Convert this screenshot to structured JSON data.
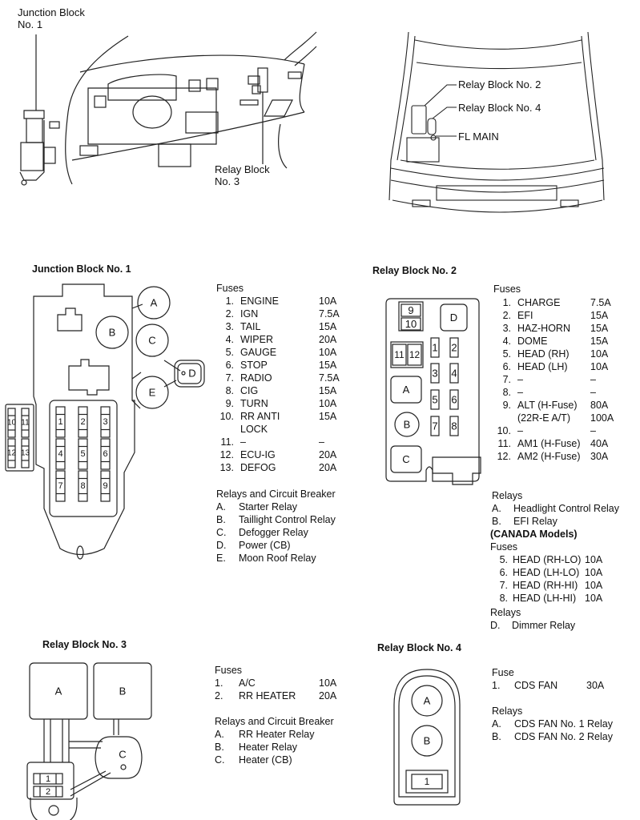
{
  "locations": {
    "junction_block_1_callout": [
      "Junction Block",
      "No. 1"
    ],
    "relay_block_3_callout": [
      "Relay Block",
      "No. 3"
    ],
    "engine_bay_callouts": [
      "Relay Block No. 2",
      "Relay Block No. 4",
      "FL MAIN"
    ]
  },
  "junction_block_1": {
    "title": "Junction Block No. 1",
    "diagram": {
      "relays": [
        "A",
        "B",
        "C",
        "D",
        "E"
      ],
      "fuse_slots": [
        "1",
        "2",
        "3",
        "4",
        "5",
        "6",
        "7",
        "8",
        "9",
        "10",
        "11",
        "12",
        "13"
      ]
    },
    "fuses_heading": "Fuses",
    "fuses": [
      {
        "num": "1.",
        "name": "ENGINE",
        "amp": "10A"
      },
      {
        "num": "2.",
        "name": "IGN",
        "amp": "7.5A"
      },
      {
        "num": "3.",
        "name": "TAIL",
        "amp": "15A"
      },
      {
        "num": "4.",
        "name": "WIPER",
        "amp": "20A"
      },
      {
        "num": "5.",
        "name": "GAUGE",
        "amp": "10A"
      },
      {
        "num": "6.",
        "name": "STOP",
        "amp": "15A"
      },
      {
        "num": "7.",
        "name": "RADIO",
        "amp": "7.5A"
      },
      {
        "num": "8.",
        "name": "CIG",
        "amp": "15A"
      },
      {
        "num": "9.",
        "name": "TURN",
        "amp": "10A"
      },
      {
        "num": "10.",
        "name": "RR ANTI",
        "amp": "15A"
      },
      {
        "num": "",
        "name": "LOCK",
        "amp": ""
      },
      {
        "num": "11.",
        "name": "–",
        "amp": "–"
      },
      {
        "num": "12.",
        "name": "ECU-IG",
        "amp": "20A"
      },
      {
        "num": "13.",
        "name": "DEFOG",
        "amp": "20A"
      }
    ],
    "relays_heading": "Relays and Circuit Breaker",
    "relays": [
      {
        "letter": "A.",
        "name": "Starter Relay"
      },
      {
        "letter": "B.",
        "name": "Taillight Control Relay"
      },
      {
        "letter": "C.",
        "name": "Defogger Relay"
      },
      {
        "letter": "D.",
        "name": "Power (CB)"
      },
      {
        "letter": "E.",
        "name": "Moon Roof Relay"
      }
    ]
  },
  "relay_block_2": {
    "title": "Relay Block No. 2",
    "diagram": {
      "relays": [
        "A",
        "B",
        "C",
        "D"
      ],
      "fuse_slots": [
        "1",
        "2",
        "3",
        "4",
        "5",
        "6",
        "7",
        "8",
        "9",
        "10",
        "11",
        "12"
      ]
    },
    "fuses_heading": "Fuses",
    "fuses": [
      {
        "num": "1.",
        "name": "CHARGE",
        "amp": "7.5A"
      },
      {
        "num": "2.",
        "name": "EFI",
        "amp": "15A"
      },
      {
        "num": "3.",
        "name": "HAZ-HORN",
        "amp": "15A"
      },
      {
        "num": "4.",
        "name": "DOME",
        "amp": "15A"
      },
      {
        "num": "5.",
        "name": "HEAD (RH)",
        "amp": "10A"
      },
      {
        "num": "6.",
        "name": "HEAD (LH)",
        "amp": "10A"
      },
      {
        "num": "7.",
        "name": "–",
        "amp": "–"
      },
      {
        "num": "8.",
        "name": "–",
        "amp": "–"
      },
      {
        "num": "9.",
        "name": "ALT (H-Fuse)",
        "amp": "80A"
      },
      {
        "num": "",
        "name": "(22R-E A/T)",
        "amp": "100A"
      },
      {
        "num": "10.",
        "name": "–",
        "amp": "–"
      },
      {
        "num": "11.",
        "name": "AM1 (H-Fuse)",
        "amp": "40A"
      },
      {
        "num": "12.",
        "name": "AM2 (H-Fuse)",
        "amp": "30A"
      }
    ],
    "relays_heading": "Relays",
    "relays": [
      {
        "letter": "A.",
        "name": "Headlight Control Relay"
      },
      {
        "letter": "B.",
        "name": "EFI Relay"
      }
    ],
    "canada_heading": "(CANADA Models)",
    "canada_fuses_heading": "Fuses",
    "canada_fuses": [
      {
        "num": "5.",
        "name": "HEAD (RH-LO)",
        "amp": "10A"
      },
      {
        "num": "6.",
        "name": "HEAD (LH-LO)",
        "amp": "10A"
      },
      {
        "num": "7.",
        "name": "HEAD (RH-HI)",
        "amp": "10A"
      },
      {
        "num": "8.",
        "name": "HEAD (LH-HI)",
        "amp": "10A"
      }
    ],
    "canada_relays_heading": "Relays",
    "canada_relays": [
      {
        "letter": "D.",
        "name": "Dimmer Relay"
      }
    ]
  },
  "relay_block_3": {
    "title": "Relay Block No. 3",
    "diagram": {
      "relays": [
        "A",
        "B",
        "C"
      ],
      "fuse_slots": [
        "1",
        "2"
      ]
    },
    "fuses_heading": "Fuses",
    "fuses": [
      {
        "num": "1.",
        "name": "A/C",
        "amp": "10A"
      },
      {
        "num": "2.",
        "name": "RR HEATER",
        "amp": "20A"
      }
    ],
    "relays_heading": "Relays and Circuit Breaker",
    "relays": [
      {
        "letter": "A.",
        "name": "RR Heater Relay"
      },
      {
        "letter": "B.",
        "name": "Heater Relay"
      },
      {
        "letter": "C.",
        "name": "Heater (CB)"
      }
    ]
  },
  "relay_block_4": {
    "title": "Relay Block No. 4",
    "diagram": {
      "relays": [
        "A",
        "B"
      ],
      "fuse_slots": [
        "1"
      ]
    },
    "fuses_heading": "Fuse",
    "fuses": [
      {
        "num": "1.",
        "name": "CDS FAN",
        "amp": "30A"
      }
    ],
    "relays_heading": "Relays",
    "relays": [
      {
        "letter": "A.",
        "name": "CDS FAN No. 1 Relay"
      },
      {
        "letter": "B.",
        "name": "CDS FAN No. 2 Relay"
      }
    ]
  }
}
